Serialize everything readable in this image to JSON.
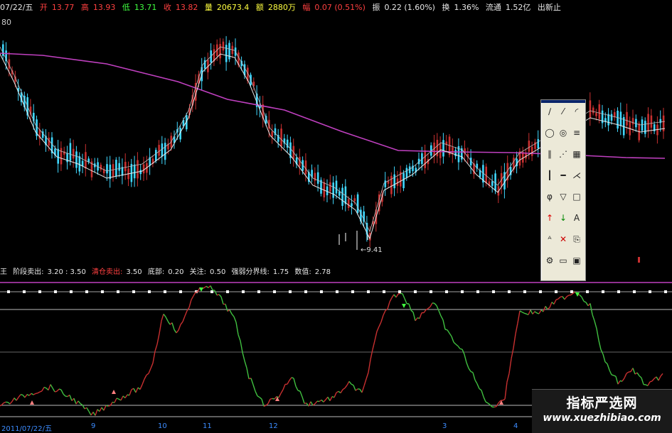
{
  "infobar": {
    "date": "07/22/五",
    "open_label": "开",
    "open": "13.77",
    "high_label": "高",
    "high": "13.93",
    "low_label": "低",
    "low": "13.71",
    "close_label": "收",
    "close": "13.82",
    "volume_label": "量",
    "volume": "20673.4",
    "amount_label": "额",
    "amount": "2880万",
    "change_label": "幅",
    "change": "0.07 (0.51%)",
    "amplitude_label": "振",
    "amplitude": "0.22 (1.60%)",
    "turnover_label": "换",
    "turnover": "1.36%",
    "float_label": "流通",
    "float": "1.52亿",
    "extra": "出新止"
  },
  "price_top_label": "80",
  "low_marker": "9.41",
  "indicator": {
    "prefix": "王",
    "stage_sell_label": "阶段卖出:",
    "stage_sell": "3.20 : 3.50",
    "clear_sell_label": "清仓卖出:",
    "clear_sell": "3.50",
    "bottom_label": "底部:",
    "bottom": "0.20",
    "watch_label": "关注:",
    "watch": "0.50",
    "divide_label": "强弱分界线:",
    "divide": "1.75",
    "value_label": "数值:",
    "value": "2.78"
  },
  "date_axis": {
    "first": "2011/07/22/五",
    "ticks": [
      "9",
      "10",
      "11",
      "12",
      "3",
      "4"
    ]
  },
  "toolbar": {
    "title": "drawing-tools",
    "buttons": [
      "line",
      "ray",
      "arc",
      "circle",
      "ellipse",
      "channel",
      "parallel",
      "fan",
      "grid",
      "vline",
      "hline",
      "gann",
      "fib",
      "triangle",
      "rect",
      "arrow-up",
      "arrow-down",
      "text",
      "text-style",
      "delete",
      "copy",
      "settings",
      "save",
      "load"
    ]
  },
  "watermark": {
    "cn": "指标严选网",
    "url": "www.xuezhibiao.com"
  },
  "colors": {
    "bull": "#c83030",
    "bear": "#40d8ff",
    "ma_long": "#c040c0",
    "ma_short": "#e8e8e8",
    "indicator_up": "#c83030",
    "indicator_down": "#40c040",
    "level_line": "#bbbbbb"
  }
}
